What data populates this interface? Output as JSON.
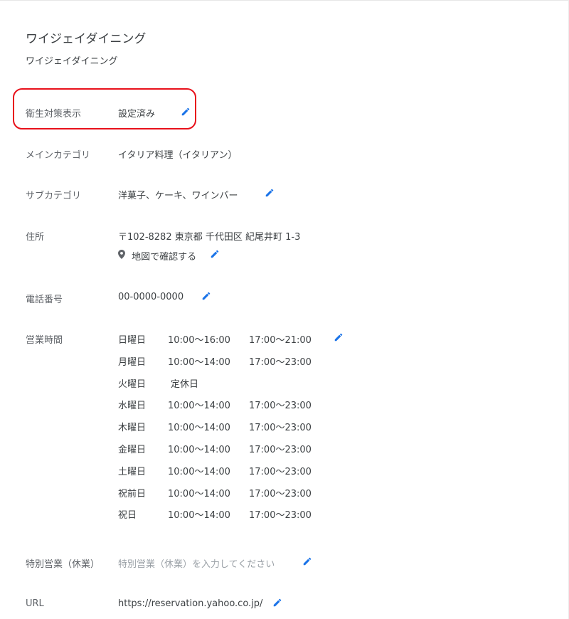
{
  "business": {
    "name_title": "ワイジェイダイニング",
    "name": "ワイジェイダイニング"
  },
  "hygiene": {
    "label": "衛生対策表示",
    "value": "設定済み"
  },
  "main_category": {
    "label": "メインカテゴリ",
    "value": "イタリア料理（イタリアン）"
  },
  "sub_category": {
    "label": "サブカテゴリ",
    "value": "洋菓子、ケーキ、ワインバー"
  },
  "address": {
    "label": "住所",
    "value": "〒102-8282 東京都 千代田区 紀尾井町 1-3",
    "map_link": "地図で確認する"
  },
  "phone": {
    "label": "電話番号",
    "value": "00-0000-0000"
  },
  "hours": {
    "label": "営業時間",
    "rows": [
      {
        "day": "日曜日",
        "slot1": "10:00〜16:00",
        "slot2": "17:00〜21:00"
      },
      {
        "day": "月曜日",
        "slot1": "10:00〜14:00",
        "slot2": "17:00〜23:00"
      },
      {
        "day": "火曜日",
        "slot1": "定休日",
        "slot2": ""
      },
      {
        "day": "水曜日",
        "slot1": "10:00〜14:00",
        "slot2": "17:00〜23:00"
      },
      {
        "day": "木曜日",
        "slot1": "10:00〜14:00",
        "slot2": "17:00〜23:00"
      },
      {
        "day": "金曜日",
        "slot1": "10:00〜14:00",
        "slot2": "17:00〜23:00"
      },
      {
        "day": "土曜日",
        "slot1": "10:00〜14:00",
        "slot2": "17:00〜23:00"
      },
      {
        "day": "祝前日",
        "slot1": "10:00〜14:00",
        "slot2": "17:00〜23:00"
      },
      {
        "day": "祝日",
        "slot1": "10:00〜14:00",
        "slot2": "17:00〜23:00"
      }
    ]
  },
  "special_hours": {
    "label": "特別営業（休業）",
    "placeholder": "特別営業（休業）を入力してください"
  },
  "url": {
    "label": "URL",
    "value": "https://reservation.yahoo.co.jp/"
  },
  "colors": {
    "accent": "#1a73e8",
    "highlight": "#e8111b",
    "label": "#5f6368",
    "text": "#3c4043"
  },
  "icons": {
    "edit": "pencil-icon",
    "map": "map-pin-icon"
  }
}
